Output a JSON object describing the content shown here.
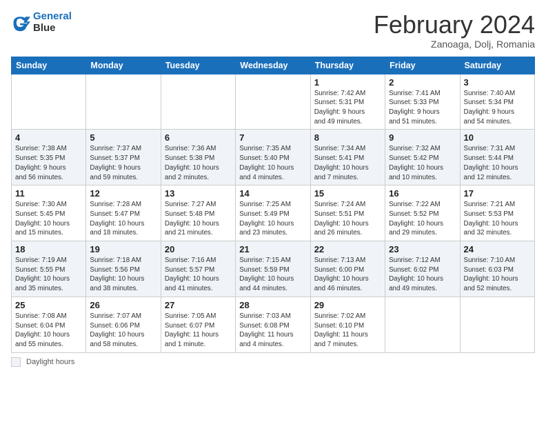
{
  "header": {
    "logo_line1": "General",
    "logo_line2": "Blue",
    "main_title": "February 2024",
    "subtitle": "Zanoaga, Dolj, Romania"
  },
  "footer": {
    "legend_label": "Daylight hours"
  },
  "calendar": {
    "days_of_week": [
      "Sunday",
      "Monday",
      "Tuesday",
      "Wednesday",
      "Thursday",
      "Friday",
      "Saturday"
    ],
    "weeks": [
      [
        {
          "num": "",
          "info": ""
        },
        {
          "num": "",
          "info": ""
        },
        {
          "num": "",
          "info": ""
        },
        {
          "num": "",
          "info": ""
        },
        {
          "num": "1",
          "info": "Sunrise: 7:42 AM\nSunset: 5:31 PM\nDaylight: 9 hours\nand 49 minutes."
        },
        {
          "num": "2",
          "info": "Sunrise: 7:41 AM\nSunset: 5:33 PM\nDaylight: 9 hours\nand 51 minutes."
        },
        {
          "num": "3",
          "info": "Sunrise: 7:40 AM\nSunset: 5:34 PM\nDaylight: 9 hours\nand 54 minutes."
        }
      ],
      [
        {
          "num": "4",
          "info": "Sunrise: 7:38 AM\nSunset: 5:35 PM\nDaylight: 9 hours\nand 56 minutes."
        },
        {
          "num": "5",
          "info": "Sunrise: 7:37 AM\nSunset: 5:37 PM\nDaylight: 9 hours\nand 59 minutes."
        },
        {
          "num": "6",
          "info": "Sunrise: 7:36 AM\nSunset: 5:38 PM\nDaylight: 10 hours\nand 2 minutes."
        },
        {
          "num": "7",
          "info": "Sunrise: 7:35 AM\nSunset: 5:40 PM\nDaylight: 10 hours\nand 4 minutes."
        },
        {
          "num": "8",
          "info": "Sunrise: 7:34 AM\nSunset: 5:41 PM\nDaylight: 10 hours\nand 7 minutes."
        },
        {
          "num": "9",
          "info": "Sunrise: 7:32 AM\nSunset: 5:42 PM\nDaylight: 10 hours\nand 10 minutes."
        },
        {
          "num": "10",
          "info": "Sunrise: 7:31 AM\nSunset: 5:44 PM\nDaylight: 10 hours\nand 12 minutes."
        }
      ],
      [
        {
          "num": "11",
          "info": "Sunrise: 7:30 AM\nSunset: 5:45 PM\nDaylight: 10 hours\nand 15 minutes."
        },
        {
          "num": "12",
          "info": "Sunrise: 7:28 AM\nSunset: 5:47 PM\nDaylight: 10 hours\nand 18 minutes."
        },
        {
          "num": "13",
          "info": "Sunrise: 7:27 AM\nSunset: 5:48 PM\nDaylight: 10 hours\nand 21 minutes."
        },
        {
          "num": "14",
          "info": "Sunrise: 7:25 AM\nSunset: 5:49 PM\nDaylight: 10 hours\nand 23 minutes."
        },
        {
          "num": "15",
          "info": "Sunrise: 7:24 AM\nSunset: 5:51 PM\nDaylight: 10 hours\nand 26 minutes."
        },
        {
          "num": "16",
          "info": "Sunrise: 7:22 AM\nSunset: 5:52 PM\nDaylight: 10 hours\nand 29 minutes."
        },
        {
          "num": "17",
          "info": "Sunrise: 7:21 AM\nSunset: 5:53 PM\nDaylight: 10 hours\nand 32 minutes."
        }
      ],
      [
        {
          "num": "18",
          "info": "Sunrise: 7:19 AM\nSunset: 5:55 PM\nDaylight: 10 hours\nand 35 minutes."
        },
        {
          "num": "19",
          "info": "Sunrise: 7:18 AM\nSunset: 5:56 PM\nDaylight: 10 hours\nand 38 minutes."
        },
        {
          "num": "20",
          "info": "Sunrise: 7:16 AM\nSunset: 5:57 PM\nDaylight: 10 hours\nand 41 minutes."
        },
        {
          "num": "21",
          "info": "Sunrise: 7:15 AM\nSunset: 5:59 PM\nDaylight: 10 hours\nand 44 minutes."
        },
        {
          "num": "22",
          "info": "Sunrise: 7:13 AM\nSunset: 6:00 PM\nDaylight: 10 hours\nand 46 minutes."
        },
        {
          "num": "23",
          "info": "Sunrise: 7:12 AM\nSunset: 6:02 PM\nDaylight: 10 hours\nand 49 minutes."
        },
        {
          "num": "24",
          "info": "Sunrise: 7:10 AM\nSunset: 6:03 PM\nDaylight: 10 hours\nand 52 minutes."
        }
      ],
      [
        {
          "num": "25",
          "info": "Sunrise: 7:08 AM\nSunset: 6:04 PM\nDaylight: 10 hours\nand 55 minutes."
        },
        {
          "num": "26",
          "info": "Sunrise: 7:07 AM\nSunset: 6:06 PM\nDaylight: 10 hours\nand 58 minutes."
        },
        {
          "num": "27",
          "info": "Sunrise: 7:05 AM\nSunset: 6:07 PM\nDaylight: 11 hours\nand 1 minute."
        },
        {
          "num": "28",
          "info": "Sunrise: 7:03 AM\nSunset: 6:08 PM\nDaylight: 11 hours\nand 4 minutes."
        },
        {
          "num": "29",
          "info": "Sunrise: 7:02 AM\nSunset: 6:10 PM\nDaylight: 11 hours\nand 7 minutes."
        },
        {
          "num": "",
          "info": ""
        },
        {
          "num": "",
          "info": ""
        }
      ]
    ]
  }
}
